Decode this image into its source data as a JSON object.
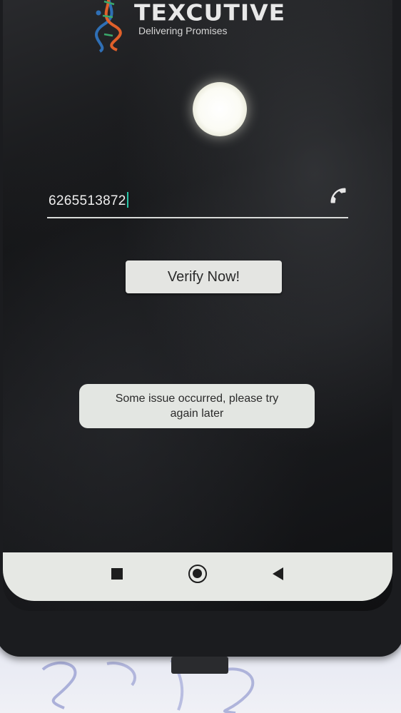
{
  "app": {
    "brand_title": "TEXCUTIVE",
    "brand_subtitle": "Delivering Promises"
  },
  "form": {
    "phone_value": "6265513872",
    "verify_label": "Verify Now!"
  },
  "toast": {
    "line1": "Some issue occurred, please try",
    "line2": "again later"
  },
  "nav": {
    "recents": "square-icon",
    "home": "circle-icon",
    "back": "triangle-back-icon"
  },
  "colors": {
    "screen_bg": "#141517",
    "text": "#eeeeee",
    "caret": "#28c7a8",
    "button_bg": "#e4e5e2",
    "toast_bg": "#e3e6e2",
    "logo_blue": "#2f6fb5",
    "logo_orange": "#e0602a",
    "logo_green": "#3aa86b"
  }
}
